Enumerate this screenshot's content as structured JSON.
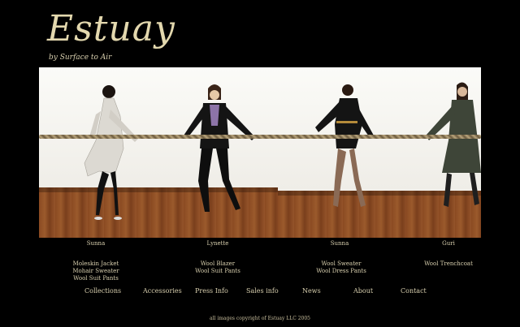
{
  "brand": {
    "title": "Estuay",
    "tagline": "by Surface to Air"
  },
  "models": [
    {
      "name": "Sunna",
      "garments": [
        "Moleskin Jacket",
        "Mohair Sweater",
        "Wool Suit Pants"
      ]
    },
    {
      "name": "Lynette",
      "garments": [
        "Wool Blazer",
        "Wool Suit Pants"
      ]
    },
    {
      "name": "Sunna",
      "garments": [
        "Wool Sweater",
        "Wool Dress Pants"
      ]
    },
    {
      "name": "Guri",
      "garments": [
        "Wool Trenchcoat"
      ]
    }
  ],
  "nav": {
    "collections": "Collections",
    "accessories": "Accessories",
    "press": "Press Info",
    "sales": "Sales info",
    "news": "News",
    "about": "About",
    "contact": "Contact"
  },
  "footer": {
    "copyright": "all images copyright of Estuay LLC 2005"
  }
}
